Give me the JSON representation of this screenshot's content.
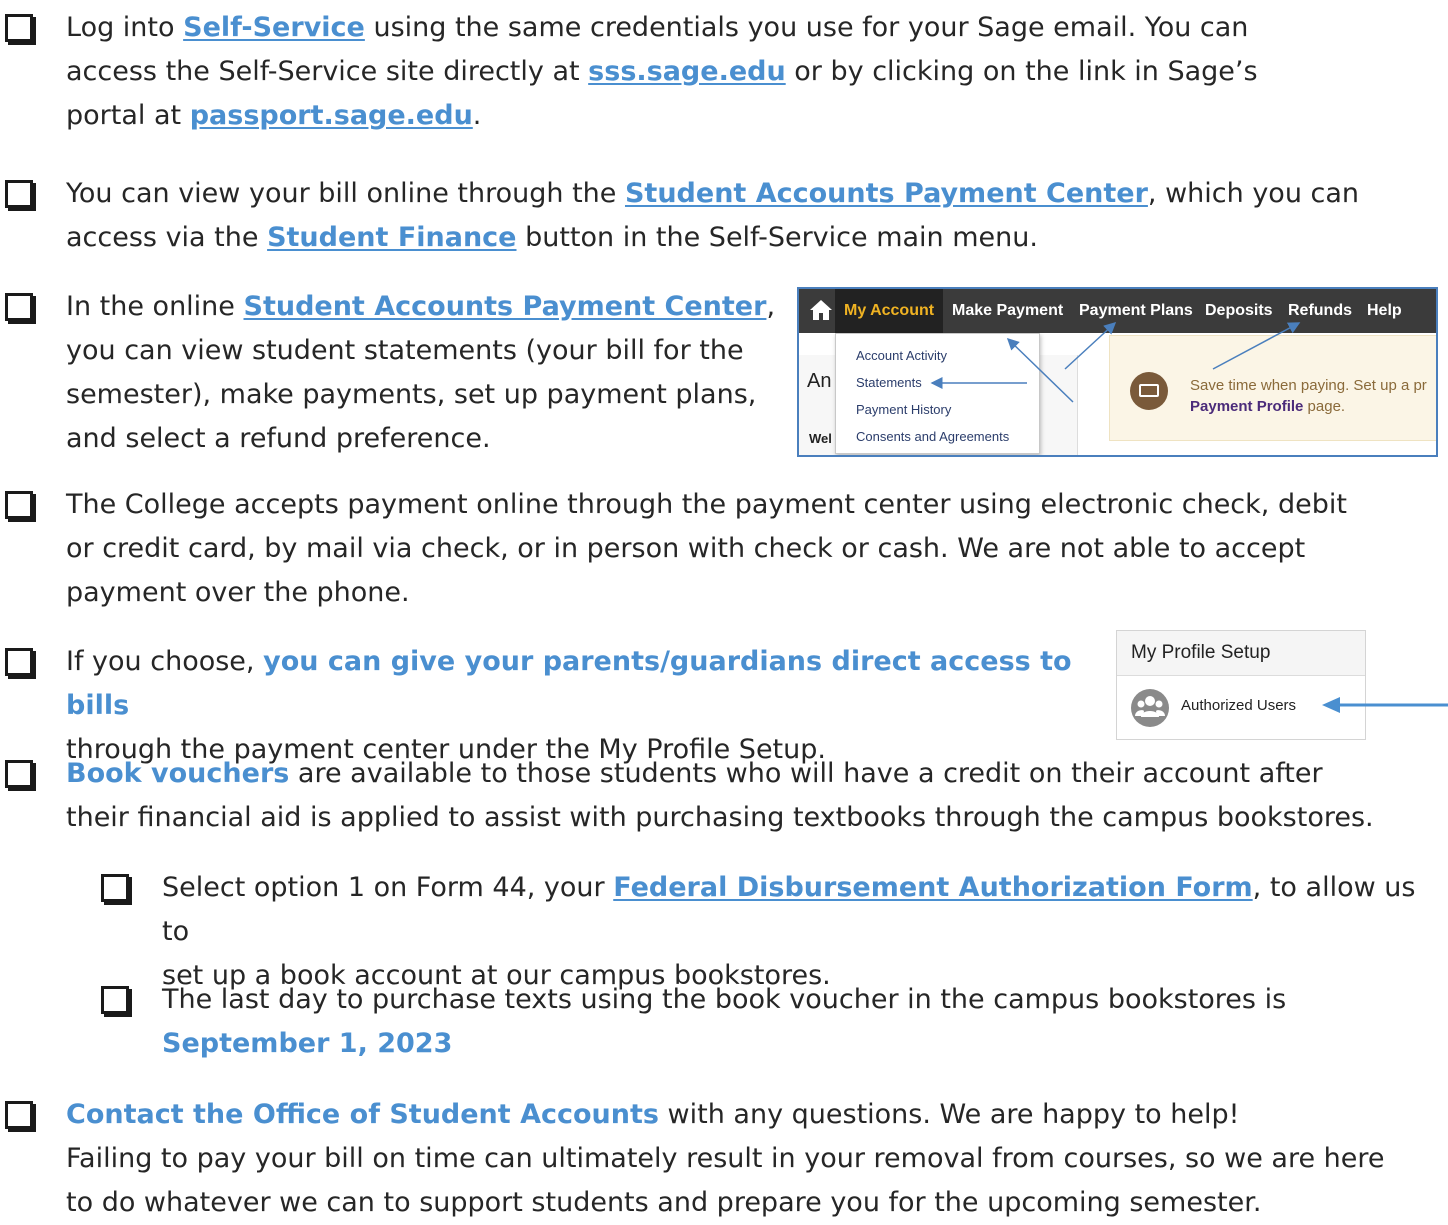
{
  "items": [
    {
      "parts": [
        {
          "t": "Log into "
        },
        {
          "t": "Self-Service",
          "link": true
        },
        {
          "t": " using the same credentials you use for your Sage email. You can"
        },
        {
          "br": true
        },
        {
          "t": "access the Self-Service site directly at "
        },
        {
          "t": "sss.sage.edu",
          "link": true
        },
        {
          "t": " or by clicking on the link in Sage’s"
        },
        {
          "br": true
        },
        {
          "t": "portal at "
        },
        {
          "t": "passport.sage.edu",
          "link": true
        },
        {
          "t": "."
        }
      ]
    },
    {
      "parts": [
        {
          "t": "You can view your bill online through the "
        },
        {
          "t": "Student Accounts Payment Center",
          "link": true
        },
        {
          "t": ", which you can"
        },
        {
          "br": true
        },
        {
          "t": "access via the "
        },
        {
          "t": "Student Finance",
          "link": true
        },
        {
          "t": " button in the Self-Service main menu."
        }
      ]
    },
    {
      "parts": [
        {
          "t": "In the online "
        },
        {
          "t": "Student Accounts Payment Center",
          "link": true
        },
        {
          "t": ","
        },
        {
          "br": true
        },
        {
          "t": "you can view student statements (your bill for the"
        },
        {
          "br": true
        },
        {
          "t": "semester), make payments, set up payment plans,"
        },
        {
          "br": true
        },
        {
          "t": "and select a refund preference."
        }
      ]
    },
    {
      "parts": [
        {
          "t": "The College accepts payment online through the payment center using electronic check, debit"
        },
        {
          "br": true
        },
        {
          "t": "or credit card, by mail via check, or in person with check or cash.  We are not able to accept"
        },
        {
          "br": true
        },
        {
          "t": "payment over the phone."
        }
      ]
    },
    {
      "parts": [
        {
          "t": "If you choose, "
        },
        {
          "t": "you can give your parents/guardians direct access to bills",
          "hl": true
        },
        {
          "br": true
        },
        {
          "t": "through the payment center under the My Profile Setup."
        }
      ]
    },
    {
      "parts": [
        {
          "t": "Book vouchers",
          "hl": true
        },
        {
          "t": " are available to those students who will have a credit on their account after"
        },
        {
          "br": true
        },
        {
          "t": "their financial aid is applied to assist with purchasing textbooks through the campus bookstores."
        }
      ]
    },
    {
      "parts": [
        {
          "t": "Select option 1 on Form 44, your "
        },
        {
          "t": "Federal Disbursement Authorization Form",
          "link": true
        },
        {
          "t": ", to allow us to"
        },
        {
          "br": true
        },
        {
          "t": "set up a book account at our campus bookstores."
        }
      ]
    },
    {
      "parts": [
        {
          "t": "The last day to purchase texts using the book voucher in the campus bookstores is"
        },
        {
          "br": true
        },
        {
          "t": "September 1, 2023",
          "hl": true
        }
      ]
    },
    {
      "parts": [
        {
          "t": "Contact the Office of Student Accounts",
          "hl": true
        },
        {
          "t": " with any questions. We are happy to help!"
        },
        {
          "br": true
        },
        {
          "t": "Failing to pay your bill on time can ultimately result in your removal from courses, so we are here"
        },
        {
          "br": true
        },
        {
          "t": "to do whatever we can to support students and prepare you for the upcoming semester."
        }
      ]
    }
  ],
  "payment_center": {
    "nav": [
      "My Account",
      "Make Payment",
      "Payment Plans",
      "Deposits",
      "Refunds",
      "Help"
    ],
    "menu": [
      "Account Activity",
      "Statements",
      "Payment History",
      "Consents and Agreements"
    ],
    "side_title": "An",
    "side_welcome": "Wel",
    "notice_line1": "Save time when paying. Set up a pr",
    "notice_link": "Payment Profile",
    "notice_line2_rest": " page.",
    "icons": [
      "home-icon",
      "money-icon"
    ]
  },
  "profile_setup": {
    "title": "My Profile Setup",
    "item": "Authorized Users",
    "icons": [
      "users-icon",
      "arrow-left-icon"
    ]
  },
  "colors": {
    "accent": "#4a8fd0",
    "body_text": "#262626",
    "nav_bg": "#3b3b3b",
    "nav_active": "#f0b323"
  }
}
